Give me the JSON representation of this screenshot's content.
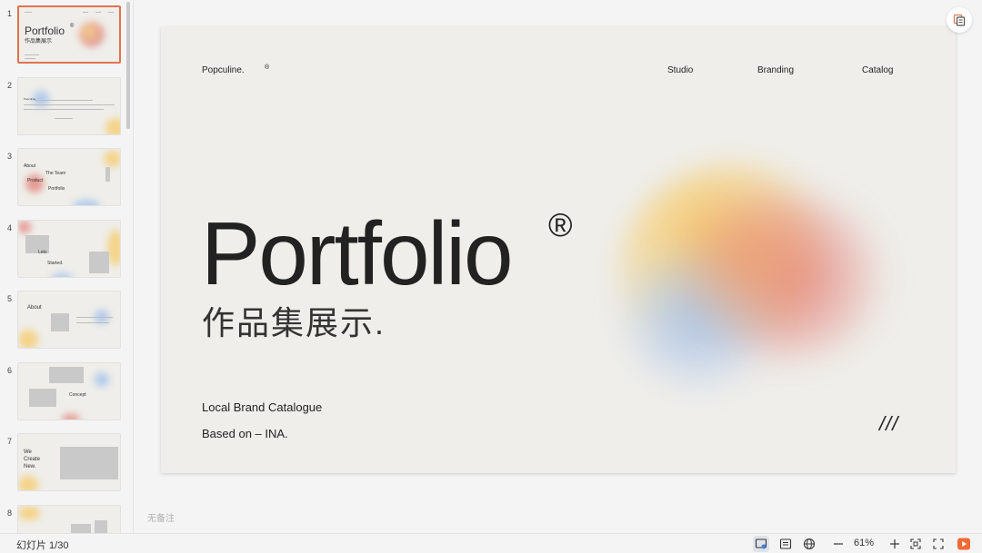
{
  "sidebar": {
    "slides": [
      {
        "number": "1",
        "title": "Portfolio",
        "reg": "®",
        "subtitle": "作品集展示"
      },
      {
        "number": "2",
        "body": "Popculine"
      },
      {
        "number": "3",
        "about": "About",
        "team": "The Team",
        "product": "Product",
        "portfolio": "Portfolio"
      },
      {
        "number": "4",
        "lets": "Lets",
        "started": "Started."
      },
      {
        "number": "5",
        "about": "About"
      },
      {
        "number": "6",
        "concept": "Concept"
      },
      {
        "number": "7",
        "we": "We",
        "create": "Create",
        "new": "New."
      },
      {
        "number": "8"
      }
    ]
  },
  "slide": {
    "brand": "Popculine.",
    "reg_small": "®",
    "nav": [
      "Studio",
      "Branding",
      "Catalog"
    ],
    "title": "Portfolio",
    "reg_big": "®",
    "subtitle_cn": "作品集展示.",
    "line1": "Local Brand Catalogue",
    "line2": "Based on  –  INA.",
    "slashes": "///"
  },
  "notes_placeholder": "无备注",
  "statusbar": {
    "slide_count": "幻灯片 1/30",
    "zoom": "61%"
  },
  "colors": {
    "accent": "#e0734e",
    "slide_bg": "#efeeea",
    "blob_yellow": "#f5cf7a",
    "blob_red": "#e48c84",
    "blob_blue": "#a9c4ea",
    "play_button": "#f06a35"
  }
}
